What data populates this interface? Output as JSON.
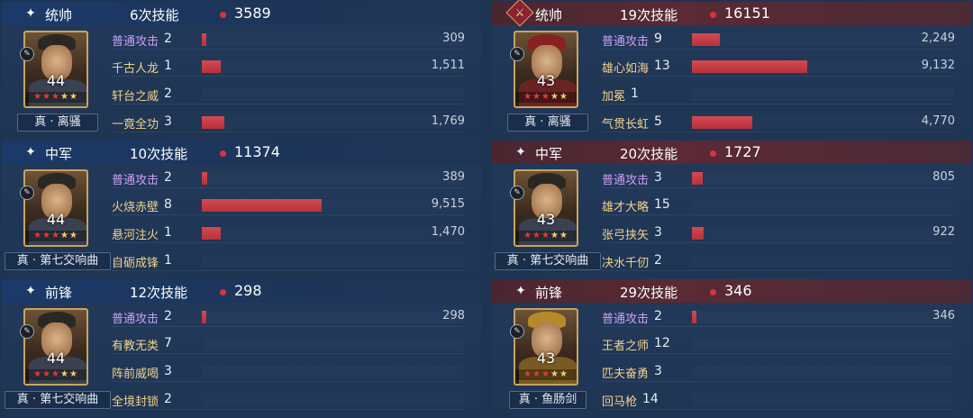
{
  "colors": {
    "left_header": "#1b3a6a",
    "right_header": "#5a2a35",
    "bar": "#c43c45",
    "normal_skill": "#c9a1f2",
    "skill": "#f2d28a"
  },
  "panels": [
    {
      "side": "left",
      "role_icon": "star-sparkle-icon",
      "role": "统帅",
      "skill_count": "6次技能",
      "total_damage": "3589",
      "level": "44",
      "equip": "真 · 离骚",
      "stars_red": 3,
      "stars_yellow": 2,
      "skills": [
        {
          "name": "普通攻击",
          "times": "2",
          "damage": "309",
          "bar_fraction": 0.018,
          "normal": true
        },
        {
          "name": "千古人龙",
          "times": "1",
          "damage": "1,511",
          "bar_fraction": 0.073,
          "normal": false
        },
        {
          "name": "轩台之威",
          "times": "2",
          "damage": "",
          "bar_fraction": 0,
          "normal": false
        },
        {
          "name": "一竟全功",
          "times": "3",
          "damage": "1,769",
          "bar_fraction": 0.085,
          "normal": false
        }
      ]
    },
    {
      "side": "right",
      "role_icon": "commander-badge-icon",
      "role": "统帅",
      "skill_count": "19次技能",
      "total_damage": "16151",
      "level": "43",
      "equip": "真 · 离骚",
      "stars_red": 3,
      "stars_yellow": 2,
      "skills": [
        {
          "name": "普通攻击",
          "times": "9",
          "damage": "2,249",
          "bar_fraction": 0.108,
          "normal": true
        },
        {
          "name": "雄心如海",
          "times": "13",
          "damage": "9,132",
          "bar_fraction": 0.44,
          "normal": false
        },
        {
          "name": "加冕",
          "times": "1",
          "damage": "",
          "bar_fraction": 0,
          "normal": false
        },
        {
          "name": "气贯长虹",
          "times": "5",
          "damage": "4,770",
          "bar_fraction": 0.23,
          "normal": false
        }
      ]
    },
    {
      "side": "left",
      "role_icon": "star-sparkle-icon",
      "role": "中军",
      "skill_count": "10次技能",
      "total_damage": "11374",
      "level": "44",
      "equip": "真 · 第七交响曲",
      "stars_red": 3,
      "stars_yellow": 2,
      "skills": [
        {
          "name": "普通攻击",
          "times": "2",
          "damage": "389",
          "bar_fraction": 0.02,
          "normal": true
        },
        {
          "name": "火烧赤壁",
          "times": "8",
          "damage": "9,515",
          "bar_fraction": 0.46,
          "normal": false
        },
        {
          "name": "悬河注火",
          "times": "1",
          "damage": "1,470",
          "bar_fraction": 0.072,
          "normal": false
        },
        {
          "name": "自砺成锋",
          "times": "1",
          "damage": "",
          "bar_fraction": 0,
          "normal": false
        }
      ]
    },
    {
      "side": "right",
      "role_icon": "star-sparkle-icon",
      "role": "中军",
      "skill_count": "20次技能",
      "total_damage": "1727",
      "level": "43",
      "equip": "真 · 第七交响曲",
      "stars_red": 3,
      "stars_yellow": 2,
      "skills": [
        {
          "name": "普通攻击",
          "times": "3",
          "damage": "805",
          "bar_fraction": 0.04,
          "normal": true
        },
        {
          "name": "雄才大略",
          "times": "15",
          "damage": "",
          "bar_fraction": 0,
          "normal": false
        },
        {
          "name": "张弓挟矢",
          "times": "3",
          "damage": "922",
          "bar_fraction": 0.045,
          "normal": false
        },
        {
          "name": "决水千仞",
          "times": "2",
          "damage": "",
          "bar_fraction": 0,
          "normal": false
        }
      ]
    },
    {
      "side": "left",
      "role_icon": "star-sparkle-icon",
      "role": "前锋",
      "skill_count": "12次技能",
      "total_damage": "298",
      "level": "44",
      "equip": "真 · 第七交响曲",
      "stars_red": 3,
      "stars_yellow": 2,
      "skills": [
        {
          "name": "普通攻击",
          "times": "2",
          "damage": "298",
          "bar_fraction": 0.016,
          "normal": true
        },
        {
          "name": "有教无类",
          "times": "7",
          "damage": "",
          "bar_fraction": 0,
          "normal": false
        },
        {
          "name": "阵前威喝",
          "times": "3",
          "damage": "",
          "bar_fraction": 0,
          "normal": false
        },
        {
          "name": "全境封锁",
          "times": "2",
          "damage": "",
          "bar_fraction": 0,
          "normal": false
        }
      ]
    },
    {
      "side": "right",
      "role_icon": "star-sparkle-icon",
      "role": "前锋",
      "skill_count": "29次技能",
      "total_damage": "346",
      "level": "43",
      "equip": "真 · 鱼肠剑",
      "stars_red": 3,
      "stars_yellow": 2,
      "skills": [
        {
          "name": "普通攻击",
          "times": "2",
          "damage": "346",
          "bar_fraction": 0.017,
          "normal": true
        },
        {
          "name": "王者之师",
          "times": "12",
          "damage": "",
          "bar_fraction": 0,
          "normal": false
        },
        {
          "name": "匹夫奋勇",
          "times": "3",
          "damage": "",
          "bar_fraction": 0,
          "normal": false
        },
        {
          "name": "回马枪",
          "times": "14",
          "damage": "",
          "bar_fraction": 0,
          "normal": false
        }
      ]
    }
  ]
}
